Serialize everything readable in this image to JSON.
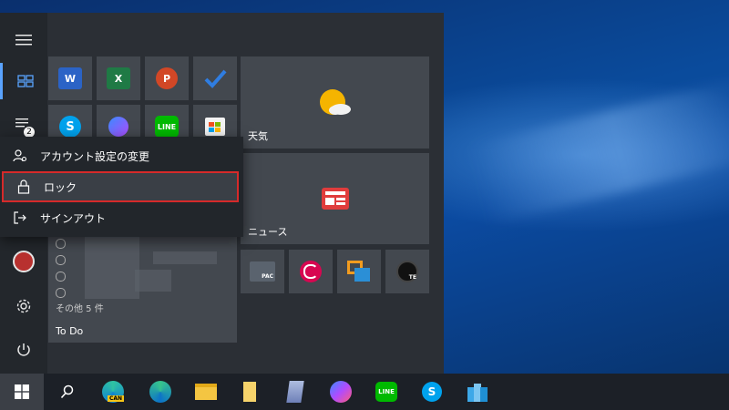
{
  "start_menu": {
    "rail": {
      "hamburger_icon": "hamburger-icon",
      "tiles_icon": "all-tiles-icon",
      "list_icon": "all-apps-icon",
      "badge": "2",
      "settings_icon": "gear-icon",
      "power_icon": "power-icon"
    },
    "user_menu": {
      "items": [
        {
          "label": "アカウント設定の変更",
          "icon": "person-gear-icon"
        },
        {
          "label": "ロック",
          "icon": "lock-icon",
          "selected": true
        },
        {
          "label": "サインアウト",
          "icon": "sign-out-icon"
        }
      ]
    },
    "tiles": {
      "weather_label": "天気",
      "news_label": "ニュース",
      "todo": {
        "more_label": "その他 5 件",
        "title": "To Do"
      },
      "small_app_labels": {
        "word": "W",
        "excel": "X",
        "powerpoint": "P",
        "skype": "S",
        "line": "LINE",
        "terminal": "PAC",
        "app_badge": "TE"
      }
    }
  },
  "taskbar": {
    "items": [
      {
        "name": "windows-start",
        "label": ""
      },
      {
        "name": "search",
        "label": ""
      },
      {
        "name": "edge-canary",
        "label": "CAN"
      },
      {
        "name": "edge",
        "label": ""
      },
      {
        "name": "file-explorer",
        "label": ""
      },
      {
        "name": "notepad",
        "label": ""
      },
      {
        "name": "app",
        "label": ""
      },
      {
        "name": "messenger",
        "label": ""
      },
      {
        "name": "line",
        "label": "LINE"
      },
      {
        "name": "skype",
        "label": "S"
      },
      {
        "name": "azure",
        "label": ""
      }
    ]
  },
  "colors": {
    "accent": "#5aa3ff",
    "highlight_border": "#d62a2a",
    "menu_bg": "#2b2f35",
    "tile_bg": "#43484f"
  }
}
